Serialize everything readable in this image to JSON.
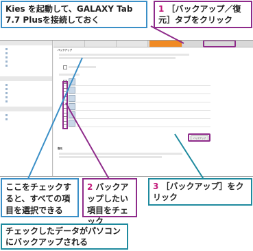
{
  "callouts": {
    "top_left": "Kies を起動して、GALAXY Tab 7.7 Plusを接続しておく",
    "step1_num": "1",
    "step1_text": "［バックアップ／復元］タブをクリック",
    "bottom_left": "ここをチェックすると、すべての項目を選択できる",
    "step2_num": "2",
    "step2_text": "バックアップしたい項目をチェック",
    "step3_num": "3",
    "step3_text": "［バックアップ］をクリック",
    "bottom": "チェックしたデータがパソコンにバックアップされる"
  },
  "colors": {
    "blue_frame": "#3a8fc7",
    "purple_frame": "#8e2a8a",
    "teal_frame": "#1e8a9e",
    "number_pink": "#c2187a",
    "active_tab": "#f08a24"
  },
  "screen": {
    "sections": {
      "backup": "バックアップ",
      "restore": "復元"
    },
    "backup_button": "バックアップ"
  }
}
